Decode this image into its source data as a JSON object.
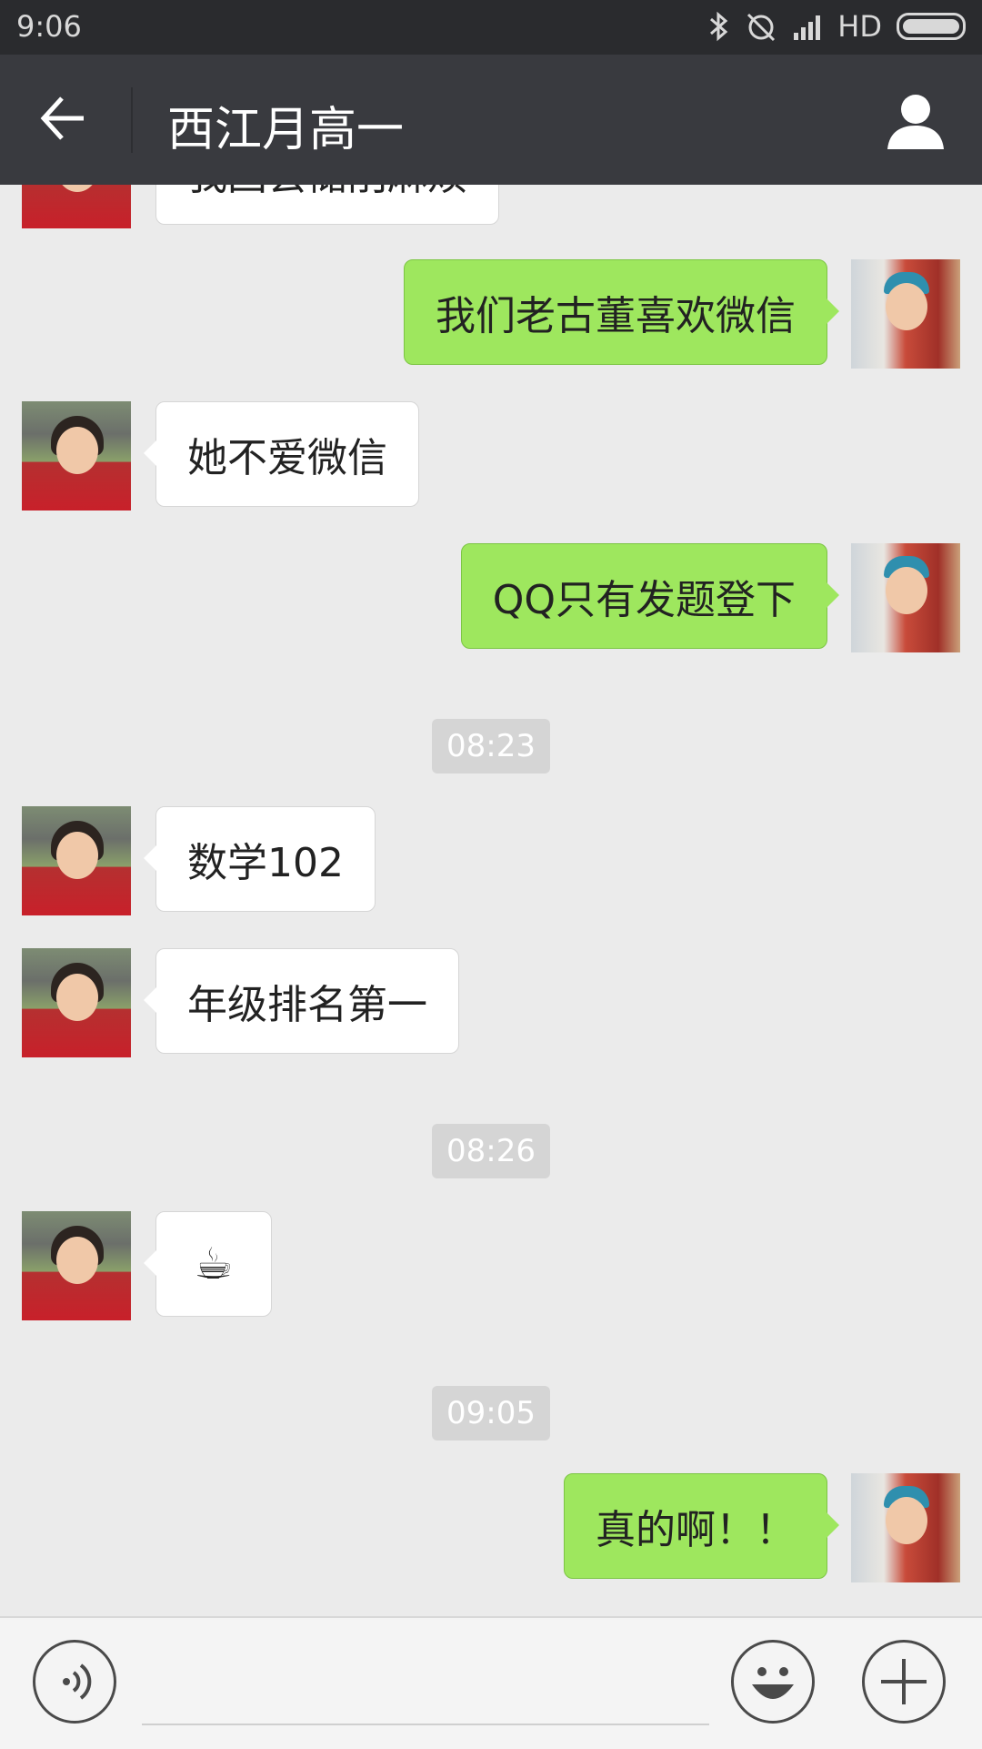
{
  "status_bar": {
    "time": "9:06",
    "network_label": "HD"
  },
  "header": {
    "title": "西江月高一",
    "back_icon": "arrow-left-icon",
    "profile_icon": "person-icon"
  },
  "colors": {
    "title_bar_bg": "#393a3f",
    "chat_bg": "#ebebeb",
    "outgoing_bubble": "#9ee75e",
    "incoming_bubble": "#ffffff"
  },
  "messages": [
    {
      "sender": "other",
      "text": "我国会储削麻烦"
    },
    {
      "sender": "self",
      "text": "我们老古董喜欢微信"
    },
    {
      "sender": "other",
      "text": "她不爱微信"
    },
    {
      "sender": "self",
      "text": "QQ只有发题登下"
    },
    {
      "timestamp": "08:23"
    },
    {
      "sender": "other",
      "text": "数学102"
    },
    {
      "sender": "other",
      "text": "年级排名第一"
    },
    {
      "timestamp": "08:26"
    },
    {
      "sender": "other",
      "emoji": "☕",
      "emoji_name": "coffee-cup-icon"
    },
    {
      "timestamp": "09:05"
    },
    {
      "sender": "self",
      "text": "真的啊！！"
    }
  ],
  "input_bar": {
    "voice_icon": "voice-icon",
    "emoji_icon": "smiley-icon",
    "more_icon": "plus-icon",
    "input_value": ""
  }
}
